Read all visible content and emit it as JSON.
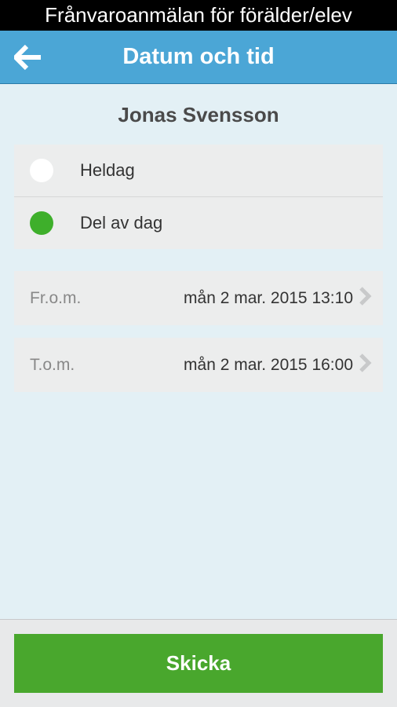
{
  "topBar": {
    "title": "Frånvaroanmälan för förälder/elev"
  },
  "nav": {
    "title": "Datum och tid"
  },
  "student": {
    "name": "Jonas Svensson"
  },
  "options": [
    {
      "label": "Heldag",
      "selected": false
    },
    {
      "label": "Del av dag",
      "selected": true
    }
  ],
  "dates": {
    "fromLabel": "Fr.o.m.",
    "fromValue": "mån 2 mar. 2015 13:10",
    "toLabel": "T.o.m.",
    "toValue": "mån 2 mar. 2015 16:00"
  },
  "footer": {
    "sendLabel": "Skicka"
  }
}
